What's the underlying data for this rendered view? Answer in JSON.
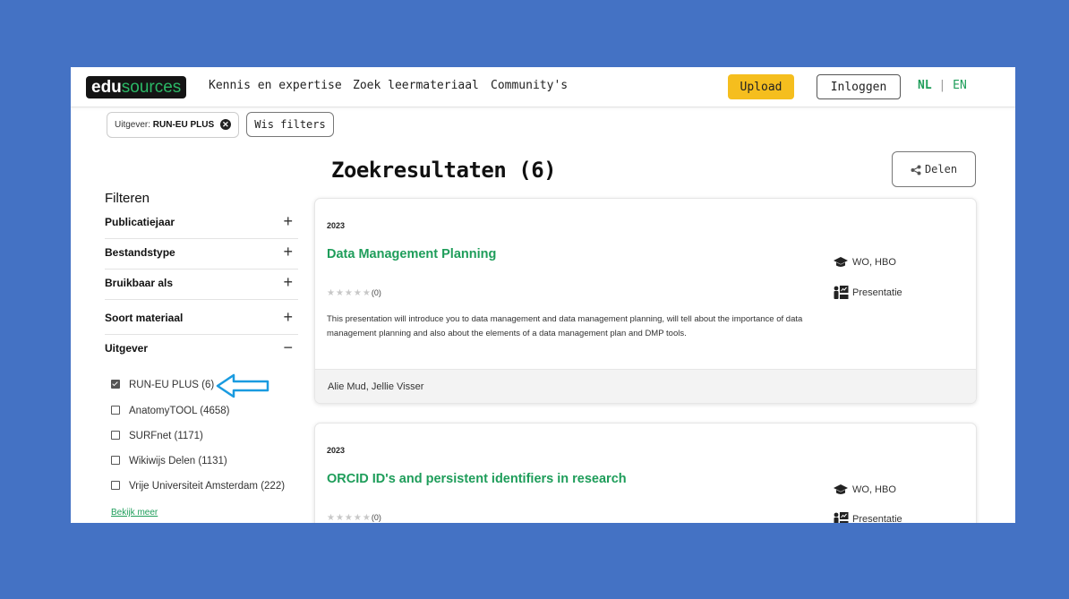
{
  "nav": {
    "logo_a": "edu",
    "logo_b": "sources",
    "links": [
      "Kennis en expertise",
      "Zoek leermateriaal",
      "Community's"
    ],
    "upload_label": "Upload",
    "login_label": "Inloggen",
    "lang_nl": "NL",
    "lang_sep": "|",
    "lang_en": "EN"
  },
  "active_filter": {
    "key": "Uitgever:",
    "value": "RUN-EU PLUS",
    "clear_label": "Wis filters"
  },
  "sidebar": {
    "title": "Filteren",
    "facets": [
      {
        "label": "Publicatiejaar",
        "sign": "+"
      },
      {
        "label": "Bestandstype",
        "sign": "+"
      },
      {
        "label": "Bruikbaar als",
        "sign": "+"
      },
      {
        "label": "Soort materiaal",
        "sign": "+"
      },
      {
        "label": "Uitgever",
        "sign": "−"
      }
    ],
    "publisher_options": [
      {
        "label": "RUN-EU PLUS (6)",
        "checked": true
      },
      {
        "label": "AnatomyTOOL (4658)",
        "checked": false
      },
      {
        "label": "SURFnet (1171)",
        "checked": false
      },
      {
        "label": "Wikiwijs Delen (1131)",
        "checked": false
      },
      {
        "label": "Vrije Universiteit Amsterdam (222)",
        "checked": false
      }
    ],
    "more_label": "Bekijk meer"
  },
  "results": {
    "title": "Zoekresultaten (6)",
    "share_label": "Delen",
    "items": [
      {
        "year": "2023",
        "title": "Data Management Planning",
        "rating_count": "(0)",
        "description": "This presentation will introduce you to data management and data management planning, will tell about the importance of data management planning and also about the elements of a data management plan and DMP tools.",
        "level": "WO, HBO",
        "type": "Presentatie",
        "authors": "Alie Mud, Jellie Visser"
      },
      {
        "year": "2023",
        "title": "ORCID ID's and persistent identifiers in research",
        "rating_count": "(0)",
        "level": "WO, HBO",
        "type": "Presentatie"
      }
    ]
  },
  "colors": {
    "background": "#4472c4",
    "accent_green": "#1e9d5a",
    "upload_yellow": "#f5be1e",
    "annotation_arrow": "#1a9be0"
  }
}
